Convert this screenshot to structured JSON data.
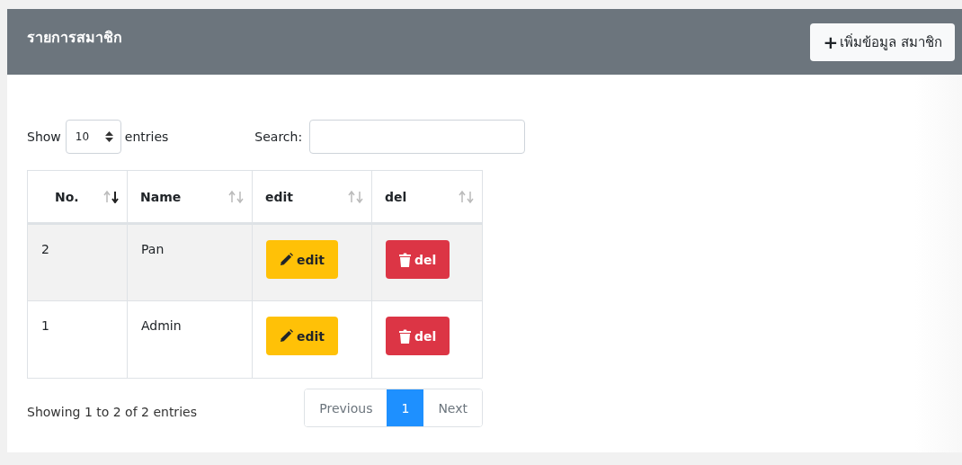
{
  "card": {
    "title": "รายการสมาชิก",
    "add_button": {
      "icon": "+",
      "label": "เพิ่มข้อมูล สมาชิก"
    }
  },
  "length_menu": {
    "before": "Show",
    "value": "10",
    "after": "entries"
  },
  "search": {
    "label": "Search:"
  },
  "table": {
    "columns": [
      {
        "label": "No.",
        "sorted": true
      },
      {
        "label": "Name",
        "sorted": false
      },
      {
        "label": "edit",
        "sorted": false
      },
      {
        "label": "del",
        "sorted": false
      }
    ],
    "rows": [
      {
        "no": "2",
        "name": "Pan",
        "edit": "edit",
        "del": "del"
      },
      {
        "no": "1",
        "name": "Admin",
        "edit": "edit",
        "del": "del"
      }
    ]
  },
  "info": "Showing 1 to 2 of 2 entries",
  "pagination": {
    "previous": {
      "label": "Previous",
      "disabled": true
    },
    "pages": [
      {
        "label": "1",
        "selected": true
      }
    ],
    "next": {
      "label": "Next",
      "disabled": true
    }
  }
}
